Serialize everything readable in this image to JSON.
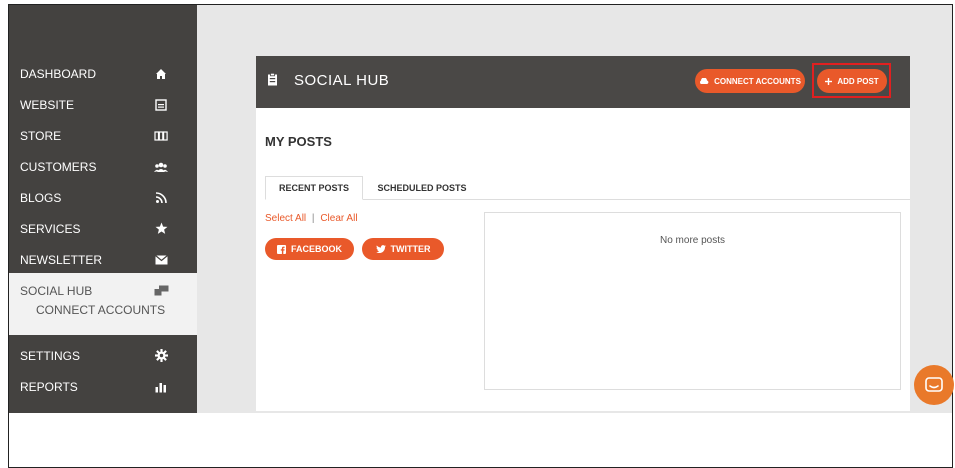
{
  "sidebar": {
    "items": [
      {
        "label": "DASHBOARD",
        "icon": "home-icon"
      },
      {
        "label": "WEBSITE",
        "icon": "website-icon"
      },
      {
        "label": "STORE",
        "icon": "store-icon"
      },
      {
        "label": "CUSTOMERS",
        "icon": "customers-icon"
      },
      {
        "label": "BLOGS",
        "icon": "rss-icon"
      },
      {
        "label": "SERVICES",
        "icon": "star-icon"
      },
      {
        "label": "NEWSLETTER",
        "icon": "envelope-icon"
      },
      {
        "label": "SOCIAL HUB",
        "icon": "social-hub-icon"
      },
      {
        "label": "SETTINGS",
        "icon": "gear-icon"
      },
      {
        "label": "REPORTS",
        "icon": "bar-chart-icon"
      }
    ],
    "subitem": "CONNECT ACCOUNTS"
  },
  "panel": {
    "title": "SOCIAL HUB",
    "connect_label": "CONNECT ACCOUNTS",
    "add_label": "ADD POST"
  },
  "posts": {
    "heading": "MY POSTS",
    "tabs": [
      "RECENT POSTS",
      "SCHEDULED POSTS"
    ],
    "select_all": "Select All",
    "separator": "|",
    "clear_all": "Clear All",
    "facebook_label": "FACEBOOK",
    "twitter_label": "TWITTER",
    "empty_message": "No more posts"
  },
  "colors": {
    "sidebar": "#444240",
    "header": "#4a4846",
    "accent": "#e9592a",
    "highlight": "#e02020"
  }
}
